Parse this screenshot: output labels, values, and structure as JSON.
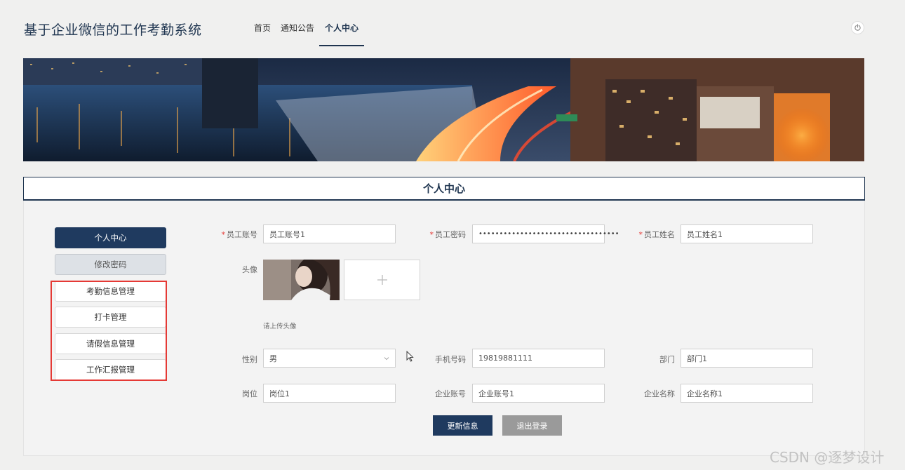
{
  "header": {
    "site_title": "基于企业微信的工作考勤系统",
    "nav": [
      {
        "label": "首页"
      },
      {
        "label": "通知公告"
      },
      {
        "label": "个人中心",
        "active": true
      }
    ],
    "power_icon": "power-icon"
  },
  "banner": {
    "description_icon": "city-night-banner"
  },
  "section": {
    "title": "个人中心"
  },
  "sidebar": {
    "items": [
      {
        "label": "个人中心",
        "style": "primary"
      },
      {
        "label": "修改密码",
        "style": "secondary"
      },
      {
        "label": "考勤信息管理",
        "style": "plain"
      },
      {
        "label": "打卡管理",
        "style": "plain"
      },
      {
        "label": "请假信息管理",
        "style": "plain"
      },
      {
        "label": "工作汇报管理",
        "style": "plain"
      }
    ]
  },
  "form": {
    "account": {
      "label": "员工账号",
      "required": "*",
      "value": "员工账号1"
    },
    "password": {
      "label": "员工密码",
      "required": "*",
      "value": "••••••••••••••••••••••••••••••••••"
    },
    "name": {
      "label": "员工姓名",
      "required": "*",
      "value": "员工姓名1"
    },
    "avatar": {
      "label": "头像",
      "hint": "请上传头像"
    },
    "gender": {
      "label": "性别",
      "value": "男"
    },
    "phone": {
      "label": "手机号码",
      "value": "19819881111"
    },
    "department": {
      "label": "部门",
      "value": "部门1"
    },
    "position": {
      "label": "岗位",
      "value": "岗位1"
    },
    "company_account": {
      "label": "企业账号",
      "value": "企业账号1"
    },
    "company_name": {
      "label": "企业名称",
      "value": "企业名称1"
    }
  },
  "buttons": {
    "update": "更新信息",
    "logout": "退出登录"
  },
  "watermark": "CSDN @逐梦设计",
  "colors": {
    "primary": "#1f3a5f",
    "highlight": "#e53935",
    "required": "#e53935"
  }
}
